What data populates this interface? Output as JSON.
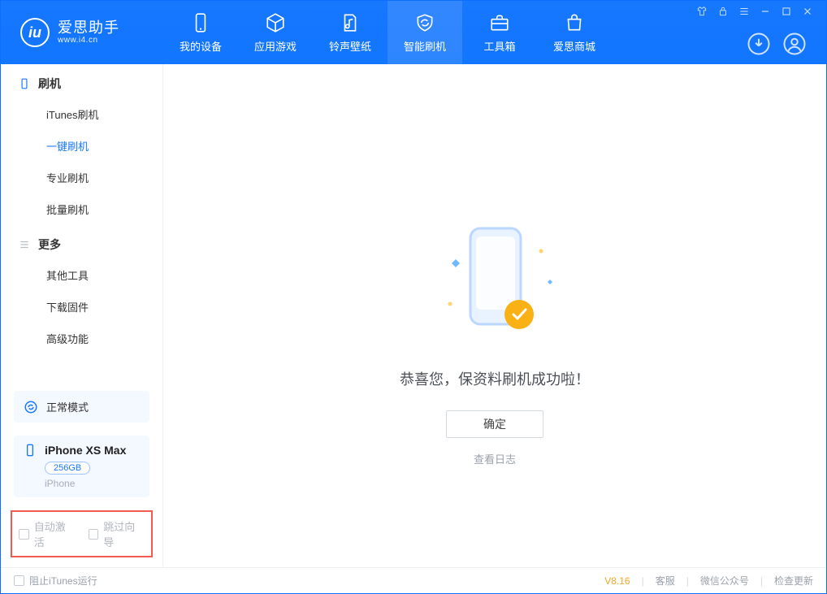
{
  "brand": {
    "title": "爱思助手",
    "subtitle": "www.i4.cn"
  },
  "nav": {
    "device": "我的设备",
    "apps": "应用游戏",
    "ringtones": "铃声壁纸",
    "flash": "智能刷机",
    "toolbox": "工具箱",
    "store": "爱思商城"
  },
  "sidebar": {
    "group_flash": "刷机",
    "items_flash": {
      "itunes": "iTunes刷机",
      "onekey": "一键刷机",
      "pro": "专业刷机",
      "batch": "批量刷机"
    },
    "group_more": "更多",
    "items_more": {
      "other": "其他工具",
      "firmware": "下载固件",
      "advanced": "高级功能"
    }
  },
  "mode": {
    "label": "正常模式"
  },
  "device": {
    "name": "iPhone XS Max",
    "storage": "256GB",
    "type": "iPhone"
  },
  "options": {
    "auto_activate": "自动激活",
    "skip_guide": "跳过向导"
  },
  "content": {
    "success": "恭喜您，保资料刷机成功啦！",
    "ok": "确定",
    "log": "查看日志"
  },
  "footer": {
    "block_itunes": "阻止iTunes运行",
    "version": "V8.16",
    "support": "客服",
    "wechat": "微信公众号",
    "update": "检查更新"
  }
}
